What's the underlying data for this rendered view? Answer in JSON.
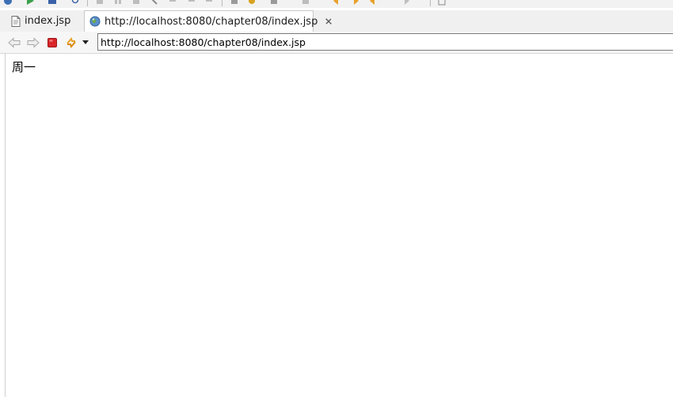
{
  "tabs": [
    {
      "label": "index.jsp",
      "icon": "jsp-file-icon",
      "active": false
    },
    {
      "label": "http://localhost:8080/chapter08/index.jsp",
      "icon": "globe-icon",
      "active": true,
      "close_icon": "close-icon"
    }
  ],
  "nav": {
    "back_icon": "back-arrow-icon",
    "forward_icon": "forward-arrow-icon",
    "stop_icon": "stop-icon",
    "refresh_icon": "refresh-icon",
    "dropdown_icon": "chevron-down-icon",
    "url": "http://localhost:8080/chapter08/index.jsp"
  },
  "page": {
    "text": "周一"
  },
  "colors": {
    "stop_red": "#d9262a",
    "refresh_orange": "#e8a22a",
    "nav_disabled": "#a8a8a8"
  }
}
